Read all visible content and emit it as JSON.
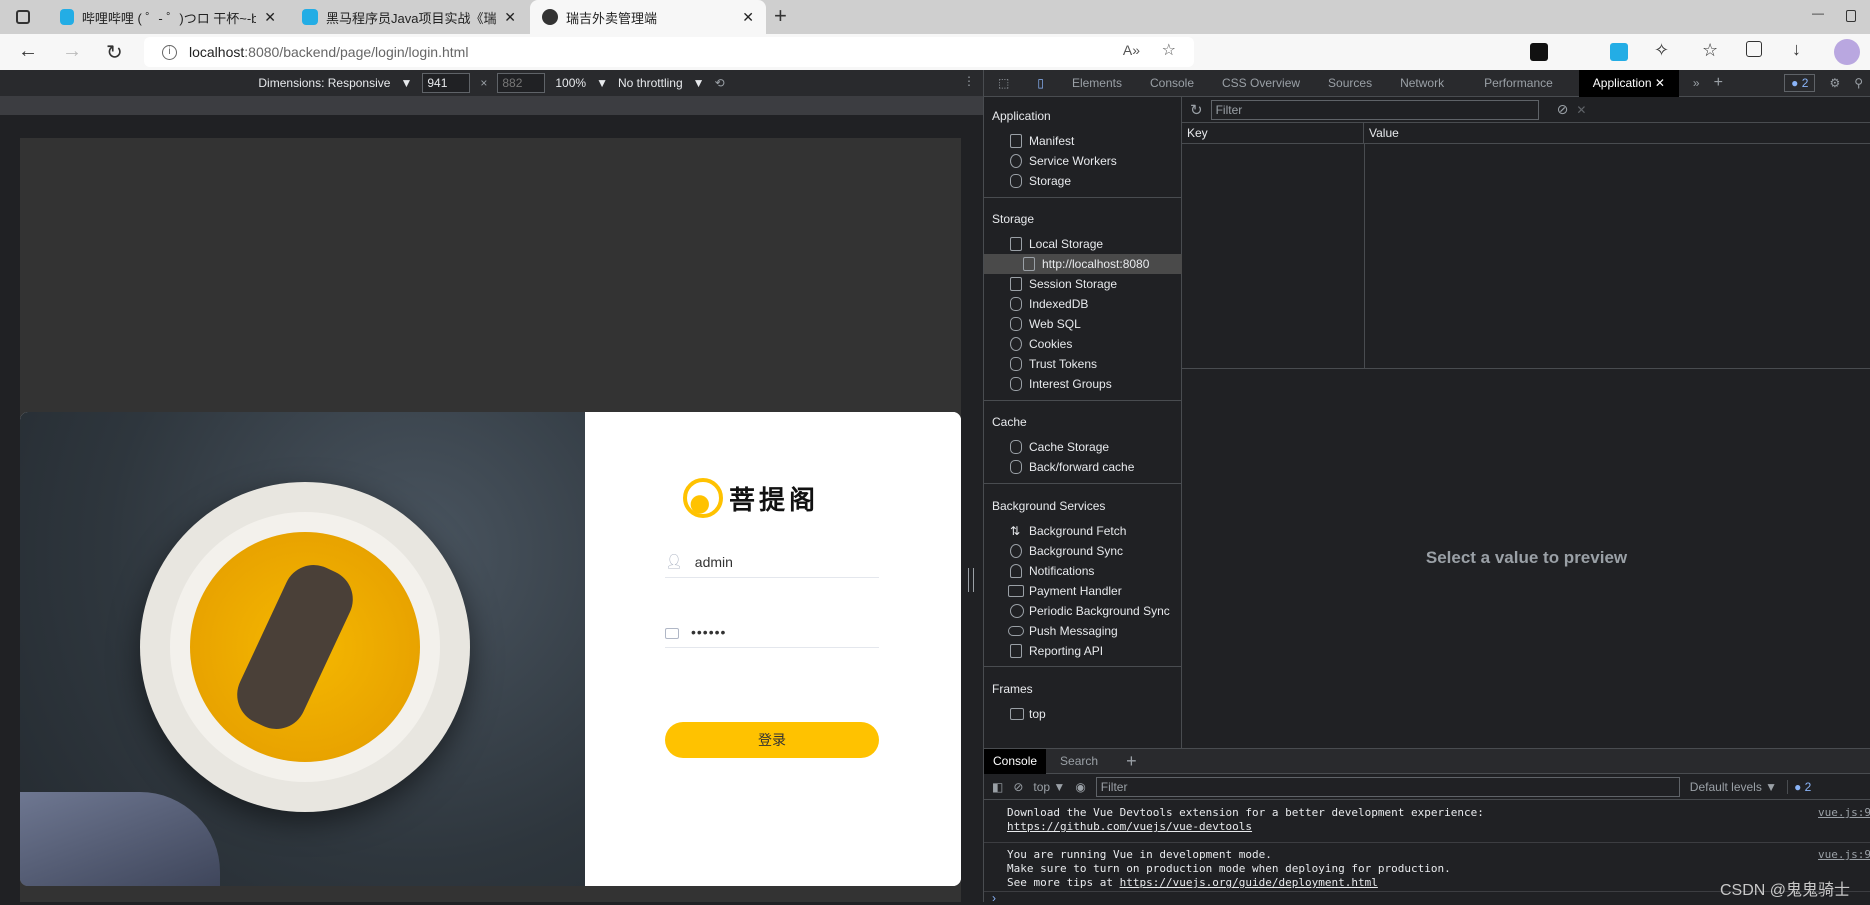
{
  "browser": {
    "tabs": [
      {
        "title": "哔哩哔哩 ( ゜- ゜)つロ 干杯~-bilibili"
      },
      {
        "title": "黑马程序员Java项目实战《瑞吉外"
      },
      {
        "title": "瑞吉外卖管理端"
      }
    ],
    "url_host": "localhost",
    "url_rest": ":8080/backend/page/login/login.html"
  },
  "device_toolbar": {
    "dimensions": "Dimensions: Responsive",
    "width": "941",
    "height": "882",
    "zoom": "100%",
    "throttling": "No throttling"
  },
  "login": {
    "brand": "菩提阁",
    "username": "admin",
    "password": "••••••",
    "submit": "登录",
    "accent": "#ffc200"
  },
  "devtools": {
    "tabs": [
      "Elements",
      "Console",
      "CSS Overview",
      "Sources",
      "Network",
      "Performance",
      "Application"
    ],
    "issues_count": "2",
    "sidebar": {
      "application": {
        "title": "Application",
        "items": [
          "Manifest",
          "Service Workers",
          "Storage"
        ]
      },
      "storage": {
        "title": "Storage",
        "items": [
          "Local Storage",
          "http://localhost:8080",
          "Session Storage",
          "IndexedDB",
          "Web SQL",
          "Cookies",
          "Trust Tokens",
          "Interest Groups"
        ]
      },
      "cache": {
        "title": "Cache",
        "items": [
          "Cache Storage",
          "Back/forward cache"
        ]
      },
      "background": {
        "title": "Background Services",
        "items": [
          "Background Fetch",
          "Background Sync",
          "Notifications",
          "Payment Handler",
          "Periodic Background Sync",
          "Push Messaging",
          "Reporting API"
        ]
      },
      "frames": {
        "title": "Frames",
        "items": [
          "top"
        ]
      }
    },
    "filter_placeholder": "Filter",
    "columns": [
      "Key",
      "Value"
    ],
    "preview": "Select a value to preview",
    "drawer": {
      "tabs": [
        "Console",
        "Search"
      ],
      "context": "top",
      "filter_placeholder": "Filter",
      "levels": "Default levels",
      "count": "2",
      "messages": [
        {
          "lines": [
            "Download the Vue Devtools extension for a better development experience:"
          ],
          "link": "https://github.com/vuejs/vue-devtools",
          "prefix": "",
          "source": "vue.js:9"
        },
        {
          "lines": [
            "You are running Vue in development mode.",
            "Make sure to turn on production mode when deploying for production."
          ],
          "prefix": "See more tips at ",
          "link": "https://vuejs.org/guide/deployment.html",
          "source": "vue.js:9"
        }
      ]
    }
  },
  "watermark": "CSDN @鬼鬼骑士"
}
